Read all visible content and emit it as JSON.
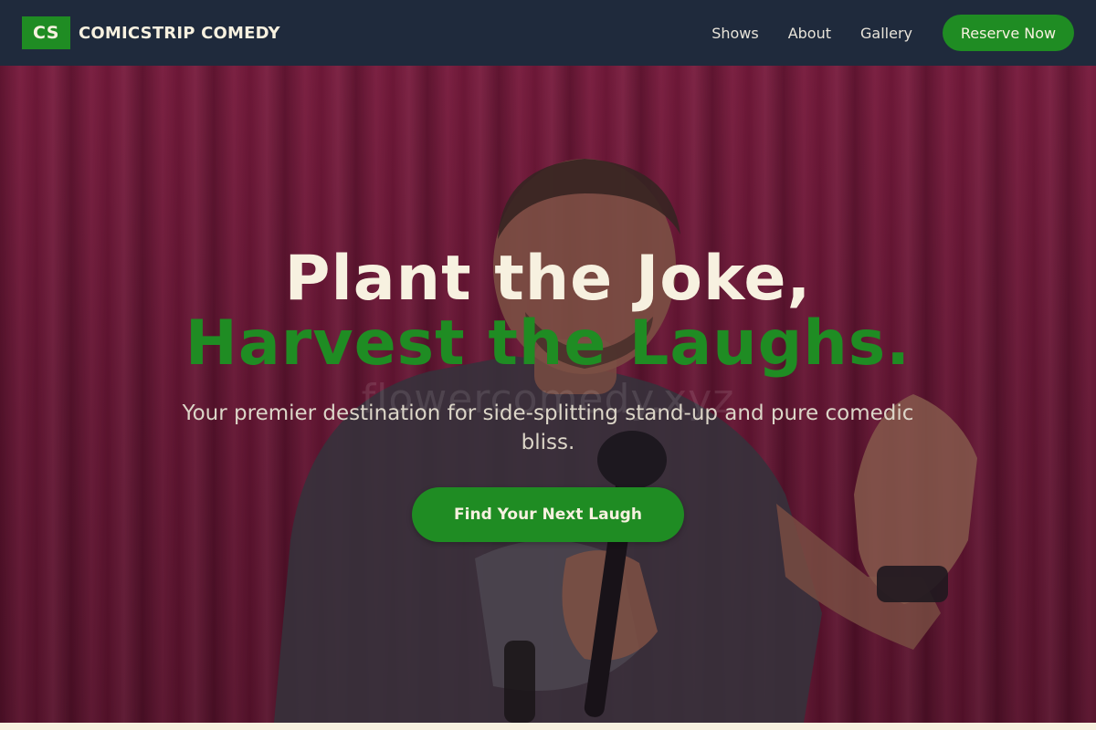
{
  "header": {
    "logo_text": "CS",
    "brand_name": "COMICSTRIP COMEDY",
    "nav": [
      {
        "label": "Shows"
      },
      {
        "label": "About"
      },
      {
        "label": "Gallery"
      }
    ],
    "cta_label": "Reserve Now"
  },
  "hero": {
    "headline_line1": "Plant the Joke,",
    "headline_line2": "Harvest the Laughs.",
    "subtitle": "Your premier destination for side-splitting stand-up and pure comedic bliss.",
    "cta_label": "Find Your Next Laugh",
    "watermark": "flowercomedy.xyz"
  },
  "colors": {
    "navbar_bg": "#1f2a3c",
    "accent_green": "#1f8c23",
    "cream": "#f7f1e0",
    "curtain_red": "#7a1a3c"
  }
}
